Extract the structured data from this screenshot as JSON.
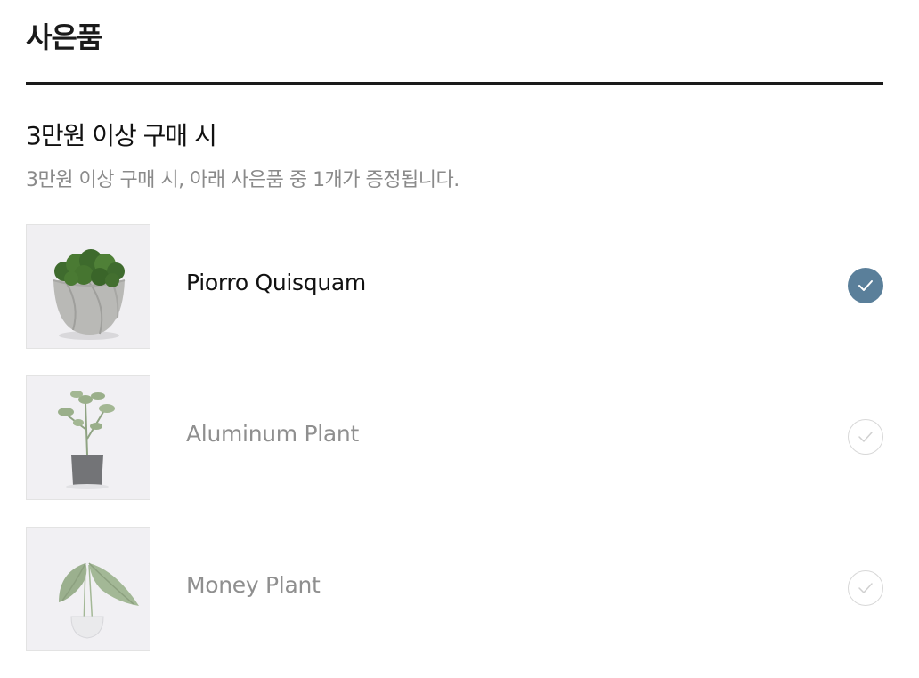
{
  "header": {
    "title": "사은품"
  },
  "section": {
    "title": "3만원 이상 구매 시",
    "description": "3만원 이상 구매 시, 아래 사은품 중 1개가 증정됩니다."
  },
  "gifts": [
    {
      "name": "Piorro Quisquam",
      "selected": true,
      "image_icon": "moss-pot-icon"
    },
    {
      "name": "Aluminum Plant",
      "selected": false,
      "image_icon": "potted-plant-icon"
    },
    {
      "name": "Money Plant",
      "selected": false,
      "image_icon": "leaf-vase-icon"
    }
  ],
  "colors": {
    "accent": "#5a7f9a",
    "title_rule": "#1a1a1a",
    "muted_text": "#8a8a8a"
  }
}
